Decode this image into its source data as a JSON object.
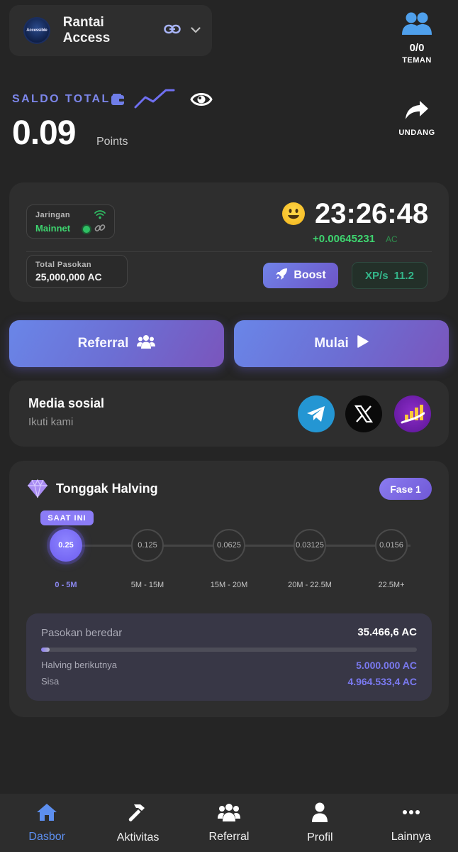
{
  "header": {
    "logo_text": "Accessible",
    "account_name": "Rantai Access",
    "friends_count": "0/0",
    "friends_label": "TEMAN",
    "invite_label": "UNDANG"
  },
  "balance": {
    "label": "SALDO TOTAL",
    "value": "0.09",
    "unit": "Points"
  },
  "status": {
    "network_label": "Jaringan",
    "network_value": "Mainnet",
    "timer": "23:26:48",
    "rate": "+0.00645231",
    "rate_unit": "AC",
    "supply_label": "Total Pasokan",
    "supply_value": "25,000,000 AC",
    "boost_label": "Boost",
    "xp_label": "XP/s",
    "xp_value": "11.2"
  },
  "actions": {
    "referral_label": "Referral",
    "start_label": "Mulai"
  },
  "social": {
    "title": "Media sosial",
    "subtitle": "Ikuti kami",
    "icons": [
      "telegram-icon",
      "x-icon",
      "stats-icon"
    ]
  },
  "halving": {
    "title": "Tonggak Halving",
    "phase": "Fase 1",
    "current_label": "SAAT INI",
    "milestones": [
      {
        "reward": "0.25",
        "range": "0 - 5M",
        "active": true
      },
      {
        "reward": "0.125",
        "range": "5M - 15M",
        "active": false
      },
      {
        "reward": "0.0625",
        "range": "15M - 20M",
        "active": false
      },
      {
        "reward": "0.03125",
        "range": "20M - 22.5M",
        "active": false
      },
      {
        "reward": "0.0156",
        "range": "22.5M+",
        "active": false
      }
    ],
    "circulating_label": "Pasokan beredar",
    "circulating_value": "35.466,6 AC",
    "progress_percent": 0.71,
    "next_label": "Halving berikutnya",
    "next_value": "5.000.000 AC",
    "remaining_label": "Sisa",
    "remaining_value": "4.964.533,4 AC"
  },
  "nav": {
    "items": [
      {
        "label": "Dasbor",
        "icon": "home-icon",
        "active": true
      },
      {
        "label": "Aktivitas",
        "icon": "hammer-icon",
        "active": false
      },
      {
        "label": "Referral",
        "icon": "users-icon",
        "active": false
      },
      {
        "label": "Profil",
        "icon": "user-icon",
        "active": false
      },
      {
        "label": "Lainnya",
        "icon": "more-icon",
        "active": false
      }
    ]
  },
  "colors": {
    "background": "#252525",
    "card": "#2e2e2e",
    "accent": "#7c86ea",
    "green": "#3ed46f",
    "nav_active": "#5d8fef"
  }
}
